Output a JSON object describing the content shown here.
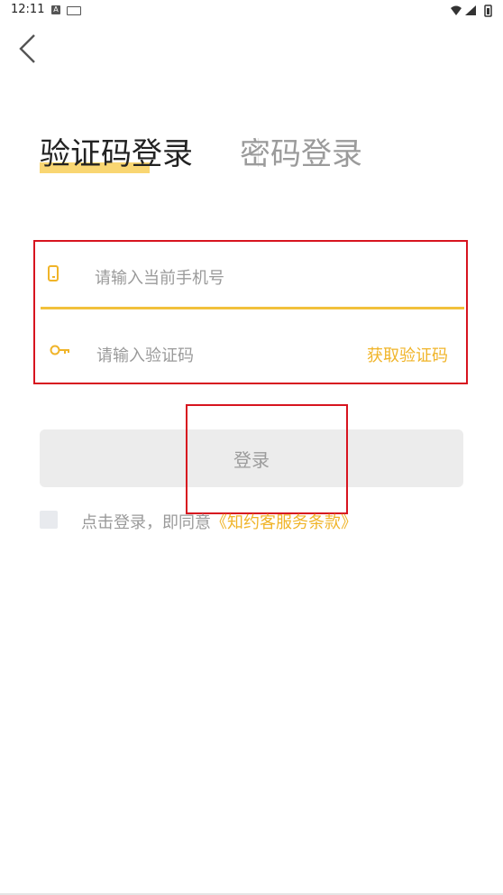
{
  "status_bar": {
    "time": "12:11",
    "a_badge": "A"
  },
  "tabs": {
    "active": "验证码登录",
    "inactive": "密码登录"
  },
  "form": {
    "phone_placeholder": "请输入当前手机号",
    "code_placeholder": "请输入验证码",
    "get_code_label": "获取验证码"
  },
  "login_button": "登录",
  "agreement": {
    "text": "点击登录，即同意",
    "link": "《知约客服务条款》"
  },
  "colors": {
    "accent": "#f0b429",
    "highlight_box": "#d7141f"
  }
}
